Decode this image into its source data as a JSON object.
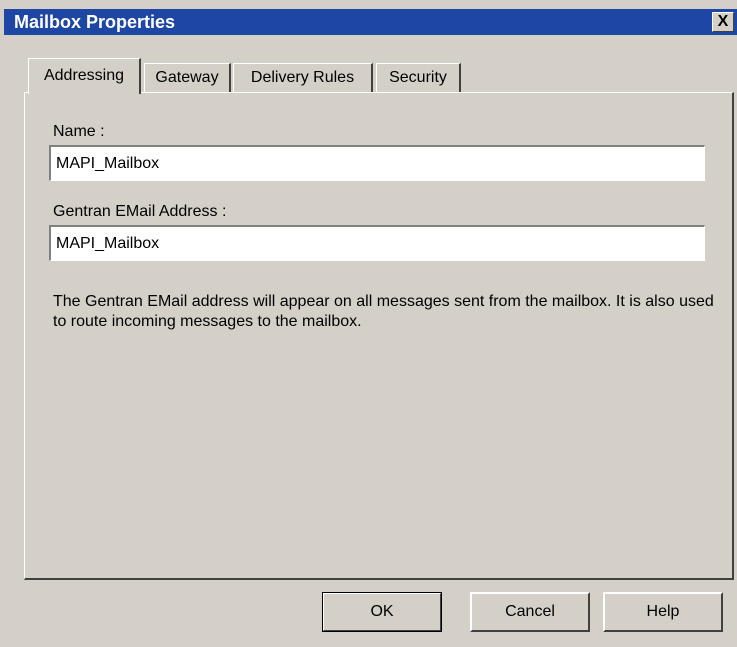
{
  "window": {
    "title": "Mailbox Properties",
    "close_label": "X"
  },
  "tabs": [
    {
      "label": "Addressing",
      "active": true
    },
    {
      "label": "Gateway",
      "active": false
    },
    {
      "label": "Delivery Rules",
      "active": false
    },
    {
      "label": "Security",
      "active": false
    }
  ],
  "form": {
    "name_label": "Name :",
    "name_value": "MAPI_Mailbox",
    "email_label": "Gentran EMail Address :",
    "email_value": "MAPI_Mailbox",
    "description": "The Gentran EMail address will appear on all messages sent from the mailbox. It is also used to route incoming messages to the mailbox."
  },
  "buttons": {
    "ok": "OK",
    "cancel": "Cancel",
    "help": "Help"
  },
  "colors": {
    "titlebar": "#1e46a5",
    "dialog_background": "#d4d0c8"
  }
}
